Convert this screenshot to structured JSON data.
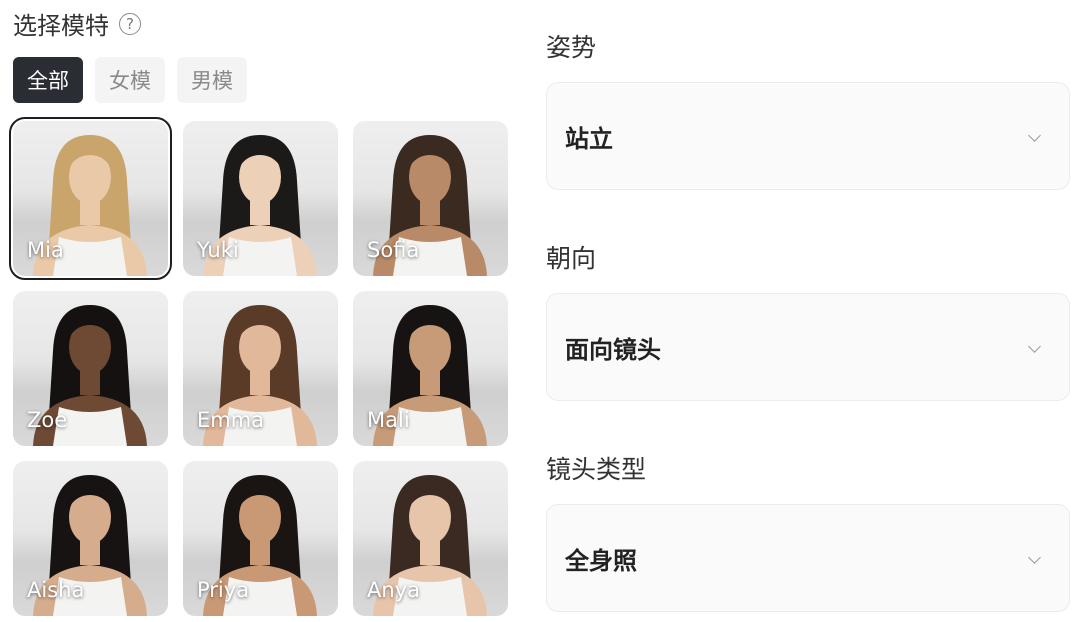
{
  "model_selector": {
    "title": "选择模特",
    "help_icon": "question-circle-icon",
    "tabs": [
      {
        "label": "全部",
        "active": true
      },
      {
        "label": "女模",
        "active": false
      },
      {
        "label": "男模",
        "active": false
      }
    ],
    "models": [
      {
        "name": "Mia",
        "selected": true,
        "hair_color": "#c9a46b",
        "skin_color": "#e9c9a8"
      },
      {
        "name": "Yuki",
        "selected": false,
        "hair_color": "#1c1a19",
        "skin_color": "#ecd0b8"
      },
      {
        "name": "Sofia",
        "selected": false,
        "hair_color": "#3a2a1f",
        "skin_color": "#b98a68"
      },
      {
        "name": "Zoe",
        "selected": false,
        "hair_color": "#151110",
        "skin_color": "#6e4a35"
      },
      {
        "name": "Emma",
        "selected": false,
        "hair_color": "#5a3b28",
        "skin_color": "#e2b89a"
      },
      {
        "name": "Mali",
        "selected": false,
        "hair_color": "#161312",
        "skin_color": "#c79b78"
      },
      {
        "name": "Aisha",
        "selected": false,
        "hair_color": "#171312",
        "skin_color": "#d6ad8c"
      },
      {
        "name": "Priya",
        "selected": false,
        "hair_color": "#1a1513",
        "skin_color": "#c99875"
      },
      {
        "name": "Anya",
        "selected": false,
        "hair_color": "#3b2a21",
        "skin_color": "#e6c5aa"
      }
    ]
  },
  "settings": {
    "pose": {
      "label": "姿势",
      "value": "站立"
    },
    "orientation": {
      "label": "朝向",
      "value": "面向镜头"
    },
    "shot_type": {
      "label": "镜头类型",
      "value": "全身照"
    }
  }
}
